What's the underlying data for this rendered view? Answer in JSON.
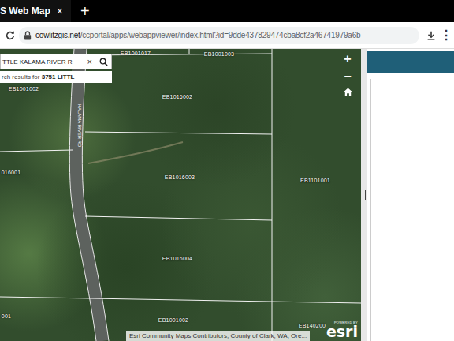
{
  "browser": {
    "tabs": [
      {
        "label": "S Web Map",
        "close": "×",
        "selected": true
      }
    ],
    "new_tab": "+",
    "url_host": "cowlitzgis.net",
    "url_path": "/ccportal/apps/webappviewer/index.html?id=9dde437829474cba8cf2a46741979a6b",
    "menu": "⋮"
  },
  "search": {
    "value": "TTLE KALAMA RIVER R",
    "clear": "×",
    "results_prefix": "rch results for ",
    "results_address": "3751 LITTL"
  },
  "map": {
    "zoom_in": "+",
    "zoom_out": "−",
    "road_label": "KALAMA RIVER RD",
    "parcels": [
      "EB1001017",
      "EB1001003",
      "EB1001002",
      "EB1016002",
      "016001",
      "EB1016003",
      "EB1101001",
      "EB1016004",
      "001",
      "EB1001002",
      "EB140200"
    ],
    "attribution": "Esri Community Maps Contributors, County of Clark, WA, Ore...",
    "logo": {
      "caption": "POWERED BY",
      "name": "esri"
    }
  }
}
